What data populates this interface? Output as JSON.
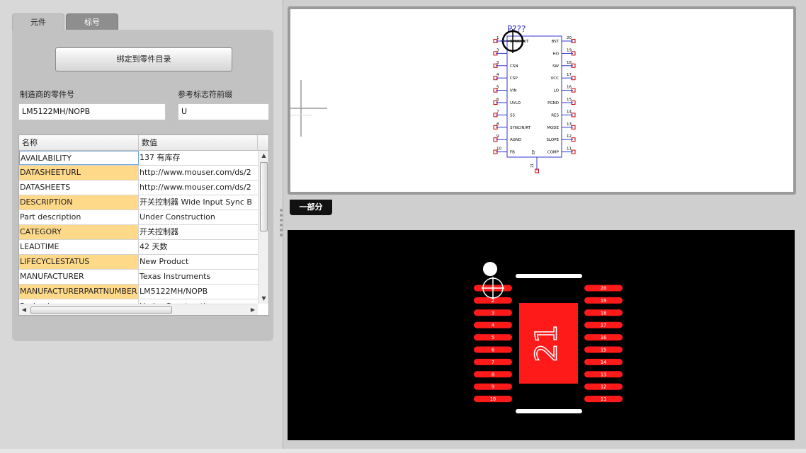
{
  "tabs": [
    {
      "label": "元件",
      "active": true
    },
    {
      "label": "标号",
      "active": false
    }
  ],
  "bind_button_label": "绑定到零件目录",
  "fields": {
    "mpn": {
      "label": "制造商的零件号",
      "value": "LM5122MH/NOPB"
    },
    "ref": {
      "label": "参考标志符前缀",
      "value": "U"
    }
  },
  "grid": {
    "columns": [
      "名称",
      "数值"
    ],
    "rows": [
      {
        "name": "AVAILABILITY",
        "value": "137 有库存",
        "highlight": false,
        "selected": true
      },
      {
        "name": "DATASHEETURL",
        "value": "http://www.mouser.com/ds/2",
        "highlight": true,
        "selected": false
      },
      {
        "name": "DATASHEETS",
        "value": "http://www.mouser.com/ds/2",
        "highlight": false,
        "selected": false
      },
      {
        "name": "DESCRIPTION",
        "value": "开关控制器  Wide Input Sync B",
        "highlight": true,
        "selected": false
      },
      {
        "name": "Part description",
        "value": "Under Construction",
        "highlight": false,
        "selected": false
      },
      {
        "name": "CATEGORY",
        "value": "开关控制器",
        "highlight": true,
        "selected": false
      },
      {
        "name": "LEADTIME",
        "value": "42 天数",
        "highlight": false,
        "selected": false
      },
      {
        "name": "LIFECYCLESTATUS",
        "value": "New Product",
        "highlight": true,
        "selected": false
      },
      {
        "name": "MANUFACTURER",
        "value": "Texas Instruments",
        "highlight": false,
        "selected": false
      },
      {
        "name": "MANUFACTURERPARTNUMBER",
        "value": "LM5122MH/NOPB",
        "highlight": true,
        "selected": false
      },
      {
        "name": "Packaging",
        "value": "Under Construction",
        "highlight": false,
        "selected": false
      }
    ]
  },
  "part_button_label": "一部分",
  "schematic": {
    "refdes": "P???",
    "left_pins": [
      {
        "num": "1",
        "name": "SYNCOUT"
      },
      {
        "num": "3",
        "name": ""
      },
      {
        "num": "3",
        "name": "CSN"
      },
      {
        "num": "4",
        "name": "CSP"
      },
      {
        "num": "5",
        "name": "VIN"
      },
      {
        "num": "6",
        "name": "UVLO"
      },
      {
        "num": "7",
        "name": "SS"
      },
      {
        "num": "8",
        "name": "SYNCIN/RT"
      },
      {
        "num": "9",
        "name": "AGND"
      },
      {
        "num": "10",
        "name": "FB"
      }
    ],
    "right_pins": [
      {
        "num": "20",
        "name": "BST"
      },
      {
        "num": "19",
        "name": "HO"
      },
      {
        "num": "18",
        "name": "SW"
      },
      {
        "num": "17",
        "name": "VCC"
      },
      {
        "num": "16",
        "name": "LO"
      },
      {
        "num": "15",
        "name": "PGND"
      },
      {
        "num": "14",
        "name": "RES"
      },
      {
        "num": "13",
        "name": "MODE"
      },
      {
        "num": "12",
        "name": "SLOPE"
      },
      {
        "num": "11",
        "name": "COMP"
      }
    ],
    "bottom_pin": {
      "num": "21",
      "name": "EP"
    }
  },
  "pcb": {
    "left_pads": [
      "1",
      "2",
      "3",
      "4",
      "5",
      "6",
      "7",
      "8",
      "9",
      "10"
    ],
    "right_pads": [
      "20",
      "19",
      "18",
      "17",
      "16",
      "15",
      "14",
      "13",
      "12",
      "11"
    ],
    "center_pad": "21"
  },
  "colors": {
    "highlight_row": "#ffd98a",
    "pad_red": "#ff1a1a",
    "schem_blue": "#3333cc",
    "pin_red": "#cc0000"
  }
}
